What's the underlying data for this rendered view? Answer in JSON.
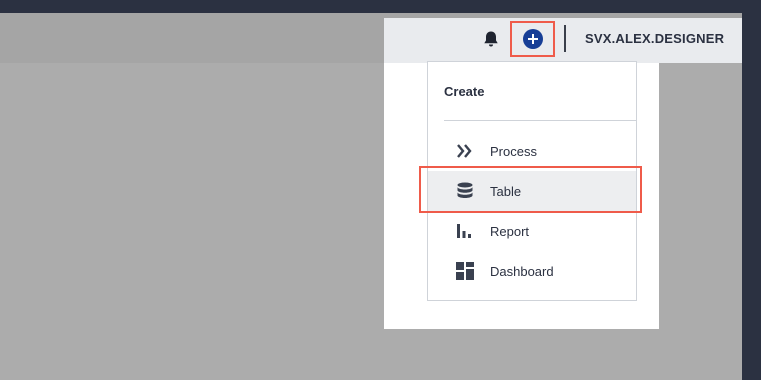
{
  "header": {
    "username": "SVX.ALEX.DESIGNER",
    "icons": [
      "bell-icon",
      "plus-circle-icon"
    ]
  },
  "create_menu": {
    "title": "Create",
    "items": [
      {
        "label": "Process",
        "icon": "chevrons-right-icon"
      },
      {
        "label": "Table",
        "icon": "database-icon",
        "highlighted": true
      },
      {
        "label": "Report",
        "icon": "bar-chart-icon"
      },
      {
        "label": "Dashboard",
        "icon": "dashboard-icon"
      }
    ]
  },
  "colors": {
    "accent": "#173e96",
    "highlight_border": "#ef5b4a",
    "text": "#2b3141"
  }
}
